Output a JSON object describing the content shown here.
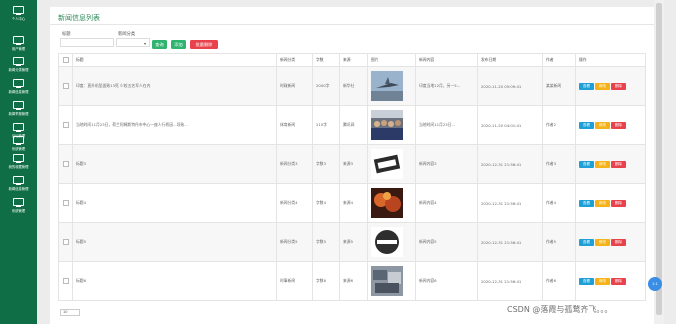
{
  "sidebar": {
    "items": [
      {
        "label": "个人中心"
      },
      {
        "label": "用户管理"
      },
      {
        "label": "新闻分类管理"
      },
      {
        "label": "新闻信息管理"
      },
      {
        "label": "新闻举报管理"
      },
      {
        "label": "论坛管理"
      },
      {
        "label": "系统管理"
      },
      {
        "label": "我的收藏管理"
      },
      {
        "label": "新闻信息管理"
      },
      {
        "label": "系统管理"
      }
    ]
  },
  "page": {
    "title": "新闻信息列表"
  },
  "filters": {
    "title_label": "标题",
    "category_label": "新闻分类",
    "title_value": "",
    "category_value": ""
  },
  "buttons": {
    "search": "查询",
    "add": "添加",
    "batch_delete": "批量删除"
  },
  "table": {
    "headers": [
      "标题",
      "新闻分类",
      "字数",
      "来源",
      "图片",
      "新闻内容",
      "发布日期",
      "作者",
      "操作"
    ],
    "rows": [
      {
        "title": "印度：直升机坠毁致13死 少校五名军人在内",
        "category": "时政新闻",
        "words": "2000字",
        "source": "新华社",
        "content": "印度当地12月，另一5...",
        "date": "2020-11-20 05:09:41",
        "author": "某某新闻"
      },
      {
        "title": "当地时间11月23日，荷兰阿姆斯特丹市中心一座人行桥因...导致...",
        "category": "体育新闻",
        "words": "210字",
        "source": "腾讯网",
        "content": "当地时间11月23日...",
        "date": "2020-11-20 04:01:41",
        "author": "作者2"
      },
      {
        "title": "标题3",
        "category": "新闻分类3",
        "words": "字数3",
        "source": "来源3",
        "content": "新闻内容3",
        "date": "2020-12-31 21:56:41",
        "author": "作者3"
      },
      {
        "title": "标题4",
        "category": "新闻分类4",
        "words": "字数4",
        "source": "来源4",
        "content": "新闻内容4",
        "date": "2020-12-31 21:56:41",
        "author": "作者4"
      },
      {
        "title": "标题5",
        "category": "新闻分类5",
        "words": "字数5",
        "source": "来源5",
        "content": "新闻内容5",
        "date": "2020-12-31 21:56:41",
        "author": "作者5"
      },
      {
        "title": "标题6",
        "category": "时事新闻",
        "words": "字数6",
        "source": "来源6",
        "content": "新闻内容6",
        "date": "2020-12-31 21:56:41",
        "author": "作者6"
      }
    ],
    "actions": {
      "view": "查看",
      "edit": "修改",
      "delete": "删除"
    }
  },
  "pager": {
    "page_size": "10"
  },
  "float_button": {
    "label": "1:1"
  },
  "watermark": "CSDN @落霞与孤鹜齐飞。。。",
  "colors": {
    "sidebar": "#0f6e45",
    "accent": "#2c8a58",
    "search": "#2eb46e",
    "add": "#2eb46e",
    "batch_delete": "#e8434c",
    "view": "#1e9fd6",
    "edit": "#f5b21b",
    "delete": "#e8434c"
  }
}
